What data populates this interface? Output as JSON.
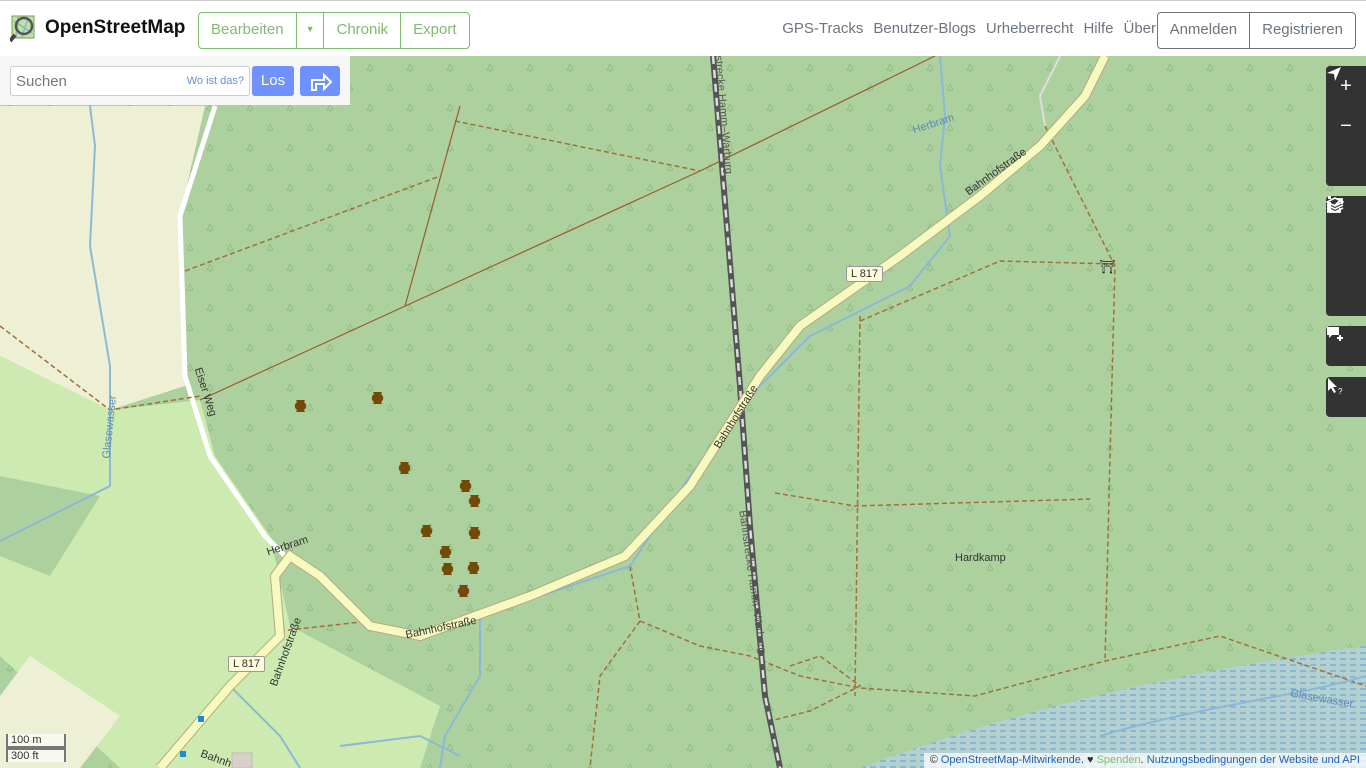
{
  "header": {
    "logo_title": "OpenStreetMap",
    "edit_label": "Bearbeiten",
    "history_label": "Chronik",
    "export_label": "Export",
    "nav": [
      "GPS-Tracks",
      "Benutzer-Blogs",
      "Urheberrecht",
      "Hilfe",
      "Über"
    ],
    "login_label": "Anmelden",
    "signup_label": "Registrieren"
  },
  "search": {
    "placeholder": "Suchen",
    "where_label": "Wo ist das?",
    "go_label": "Los"
  },
  "map": {
    "labels": {
      "road_bahnhof_1": "Bahnhofstraße",
      "road_bahnhof_2": "Bahnhofstraße",
      "road_bahnhof_3": "Bahnhofstraße",
      "rail_1": "Bahnstrecke Hamm–Warburg",
      "rail_2": "Bahnstrecke Hamm–Warburg",
      "eiser_weg": "Eiser Weg",
      "herbram_stream": "Herbram",
      "herbram_road": "Herbram",
      "glasewasser_1": "Glasewasser",
      "glasewasser_2": "Glasewasser",
      "hardkamp": "Hardkamp",
      "bahnh_partial": "Bahnh"
    },
    "shields": [
      "L 817",
      "L 817"
    ],
    "icons": {
      "archaeological_site_count": 12,
      "shelter": "shelter-icon"
    }
  },
  "controls": {
    "zoom_in": "+",
    "zoom_out": "−"
  },
  "scale": {
    "metric": "100 m",
    "imperial": "300 ft"
  },
  "attribution": {
    "copy": "©",
    "contributors": "OpenStreetMap-Mitwirkende",
    "heart": "♥",
    "donate": "Spenden",
    "terms": "Nutzungsbedingungen der Website und API"
  },
  "colors": {
    "forest": "#add19e",
    "brand_green": "#7ebc6f",
    "search_blue": "#7092ff",
    "road_yellow": "#f7fabf",
    "water": "#aad3df"
  }
}
